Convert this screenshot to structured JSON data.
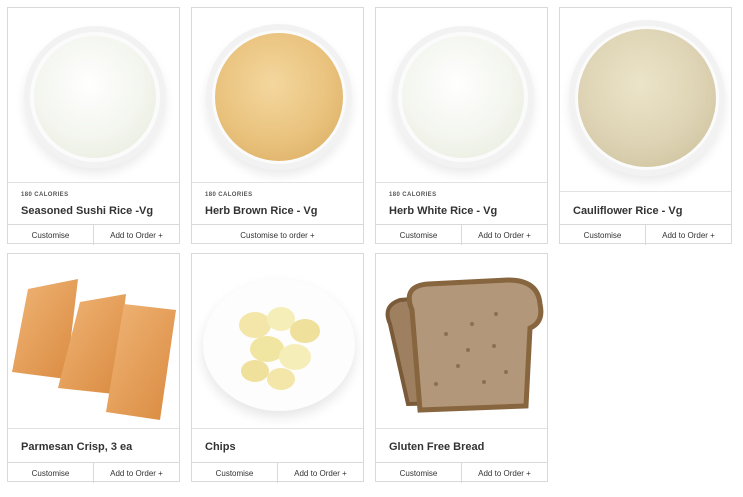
{
  "calories_label": "180 CALORIES",
  "customise_label": "Customise",
  "add_to_order_label": "Add to Order +",
  "customise_to_order_label": "Customise to order +",
  "items": [
    {
      "name": "Seasoned Sushi Rice -Vg",
      "calories": "180 CALORIES",
      "image": "white-rice-bowl"
    },
    {
      "name": "Herb Brown Rice - Vg",
      "calories": "180 CALORIES",
      "image": "brown-rice-bowl"
    },
    {
      "name": "Herb White Rice - Vg",
      "calories": "180 CALORIES",
      "image": "white-rice-bowl"
    },
    {
      "name": "Cauliflower Rice - Vg",
      "image": "cauliflower-rice-bowl"
    },
    {
      "name": "Parmesan Crisp, 3 ea",
      "image": "parmesan-crisps"
    },
    {
      "name": "Chips",
      "image": "chips-plate"
    },
    {
      "name": "Gluten Free Bread",
      "image": "bread-slices"
    }
  ],
  "colors": {
    "border": "#d9d9d9",
    "white_rice": "#f3f5ee",
    "brown_rice": "#e9c27d",
    "cauliflower": "#ddd3b4",
    "crisp": "#e59a52",
    "chips": "#f3e6a8",
    "bread": "#a98b66"
  }
}
